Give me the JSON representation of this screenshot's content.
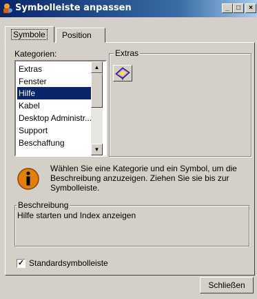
{
  "window": {
    "title": "Symbolleiste anpassen"
  },
  "tabs": [
    {
      "label": "Symbole",
      "active": true
    },
    {
      "label": "Position",
      "active": false
    }
  ],
  "categories": {
    "label": "Kategorien:",
    "items": [
      "Extras",
      "Fenster",
      "Hilfe",
      "Kabel",
      "Desktop Administr...",
      "Support",
      "Beschaffung"
    ],
    "selected": "Hilfe"
  },
  "extras": {
    "label": "Extras",
    "icon": "help-book-icon"
  },
  "info": {
    "text": "Wählen Sie eine Kategorie und ein Symbol, um die Beschreibung anzuzeigen. Ziehen Sie sie bis zur Symbolleiste.",
    "icon": "info-icon"
  },
  "description": {
    "label": "Beschreibung",
    "text": "Hilfe starten und Index anzeigen"
  },
  "standard_toolbar": {
    "label": "Standardsymbolleiste",
    "checked": true
  },
  "buttons": {
    "close": "Schließen"
  },
  "titlebar_buttons": {
    "minimize": "_",
    "maximize": "□",
    "close": "×"
  }
}
